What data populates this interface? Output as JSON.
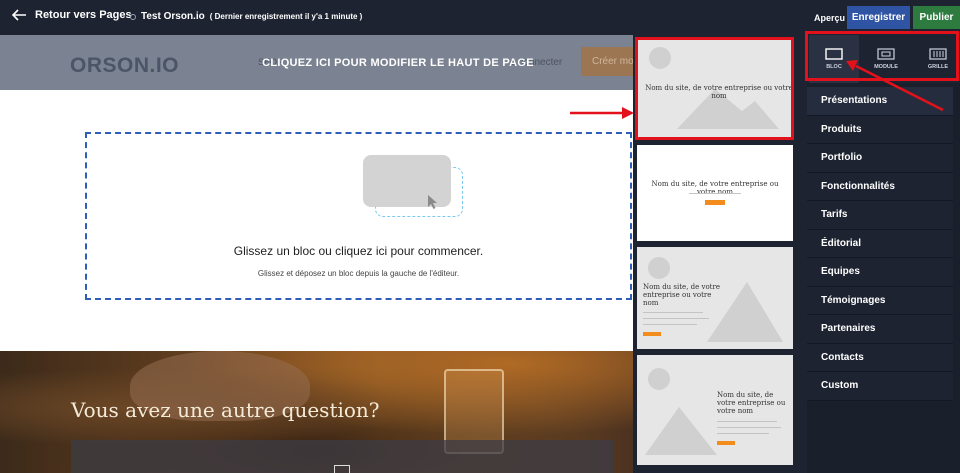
{
  "topbar": {
    "back_label": "Retour vers Pages",
    "doc_name": "Test Orson.io",
    "saved_status": "( Dernier enregistrement il y'a 1 minute )",
    "preview_label": "Aperçu",
    "save_label": "Enregistrer",
    "publish_label": "Publier"
  },
  "canvas": {
    "logo": "ORSON.IO",
    "seo_label": "SEO -",
    "header_cta": "CLIQUEZ ICI POUR MODIFIER LE HAUT DE PAGE",
    "connect_label": "e connecter",
    "create_label": "Créer mo",
    "dropzone_title": "Glissez un bloc ou cliquez ici pour commencer.",
    "dropzone_subtitle": "Glissez et déposez un bloc depuis la gauche de l'éditeur.",
    "photo_title": "Vous avez une autre question?"
  },
  "previews": [
    {
      "title": "Nom du site, de votre entreprise ou votre nom"
    },
    {
      "title": "Nom du site, de votre entreprise ou votre nom"
    },
    {
      "title": "Nom du site, de votre entreprise ou votre nom"
    },
    {
      "title": "Nom du site, de votre entreprise ou votre nom"
    }
  ],
  "sidebar": {
    "tabs": [
      {
        "label": "BLOC",
        "icon": "block-icon"
      },
      {
        "label": "MODULE",
        "icon": "module-icon"
      },
      {
        "label": "GRILLE",
        "icon": "grid-icon"
      }
    ],
    "categories": [
      "Présentations",
      "Produits",
      "Portfolio",
      "Fonctionnalités",
      "Tarifs",
      "Éditorial",
      "Equipes",
      "Témoignages",
      "Partenaires",
      "Contacts",
      "Custom"
    ]
  },
  "colors": {
    "topbar_bg": "#1d2331",
    "save_button": "#2f54a3",
    "publish_button": "#2e7b3f",
    "dropzone_border": "#2f5eb8",
    "annotation_red": "#e3111b",
    "tile_button_orange": "#f28c1c"
  }
}
